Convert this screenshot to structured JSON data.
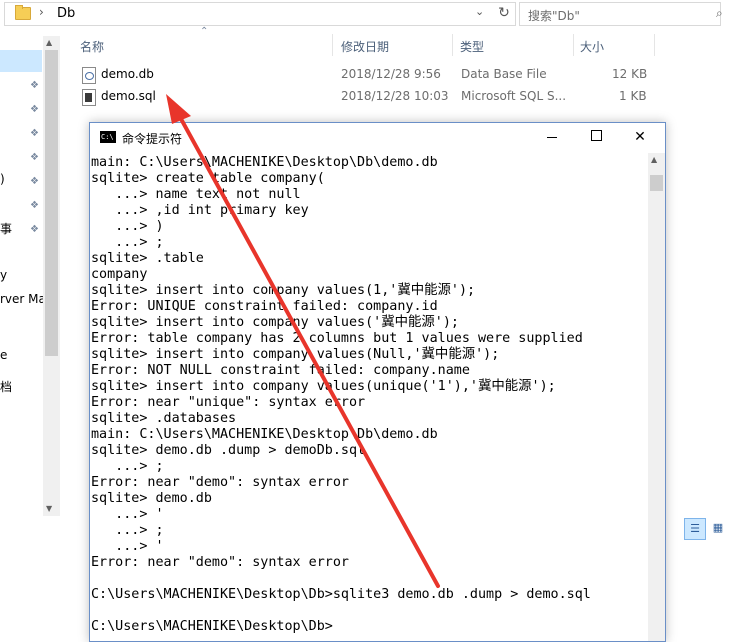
{
  "explorer": {
    "address": {
      "chevron": "›",
      "path": "Db",
      "dropdown": "⌄",
      "refresh": "↻"
    },
    "search": {
      "placeholder": "搜索\"Db\"",
      "icon": "search-icon"
    },
    "columns": {
      "name": "名称",
      "modified": "修改日期",
      "type": "类型",
      "size": "大小"
    },
    "files": [
      {
        "name": "demo.db",
        "modified": "2018/12/28 9:56",
        "type": "Data Base File",
        "size": "12 KB",
        "icon": "db-file-icon"
      },
      {
        "name": "demo.sql",
        "modified": "2018/12/28 10:03",
        "type": "Microsoft SQL S...",
        "size": "1 KB",
        "icon": "sql-file-icon"
      }
    ],
    "nav_partial_labels": [
      ")",
      "事",
      "y",
      "rver Ma",
      "e",
      "档"
    ]
  },
  "cmd": {
    "title": "命令提示符",
    "icon_text": "C:\\",
    "lines": [
      "main: C:\\Users\\MACHENIKE\\Desktop\\Db\\demo.db",
      "sqlite> create table company(",
      "   ...> name text not null",
      "   ...> ,id int primary key",
      "   ...> )",
      "   ...> ;",
      "sqlite> .table",
      "company",
      "sqlite> insert into company values(1,'冀中能源');",
      "Error: UNIQUE constraint failed: company.id",
      "sqlite> insert into company values('冀中能源');",
      "Error: table company has 2 columns but 1 values were supplied",
      "sqlite> insert into company values(Null,'冀中能源');",
      "Error: NOT NULL constraint failed: company.name",
      "sqlite> insert into company values(unique('1'),'冀中能源');",
      "Error: near \"unique\": syntax error",
      "sqlite> .databases",
      "main: C:\\Users\\MACHENIKE\\Desktop\\Db\\demo.db",
      "sqlite> demo.db .dump > demoDb.sql",
      "   ...> ;",
      "Error: near \"demo\": syntax error",
      "sqlite> demo.db",
      "   ...> '",
      "   ...> ;",
      "   ...> '",
      "Error: near \"demo\": syntax error",
      "",
      "C:\\Users\\MACHENIKE\\Desktop\\Db>sqlite3 demo.db .dump > demo.sql",
      "",
      "C:\\Users\\MACHENIKE\\Desktop\\Db>"
    ]
  },
  "annotation": {
    "color": "#e8352b"
  }
}
